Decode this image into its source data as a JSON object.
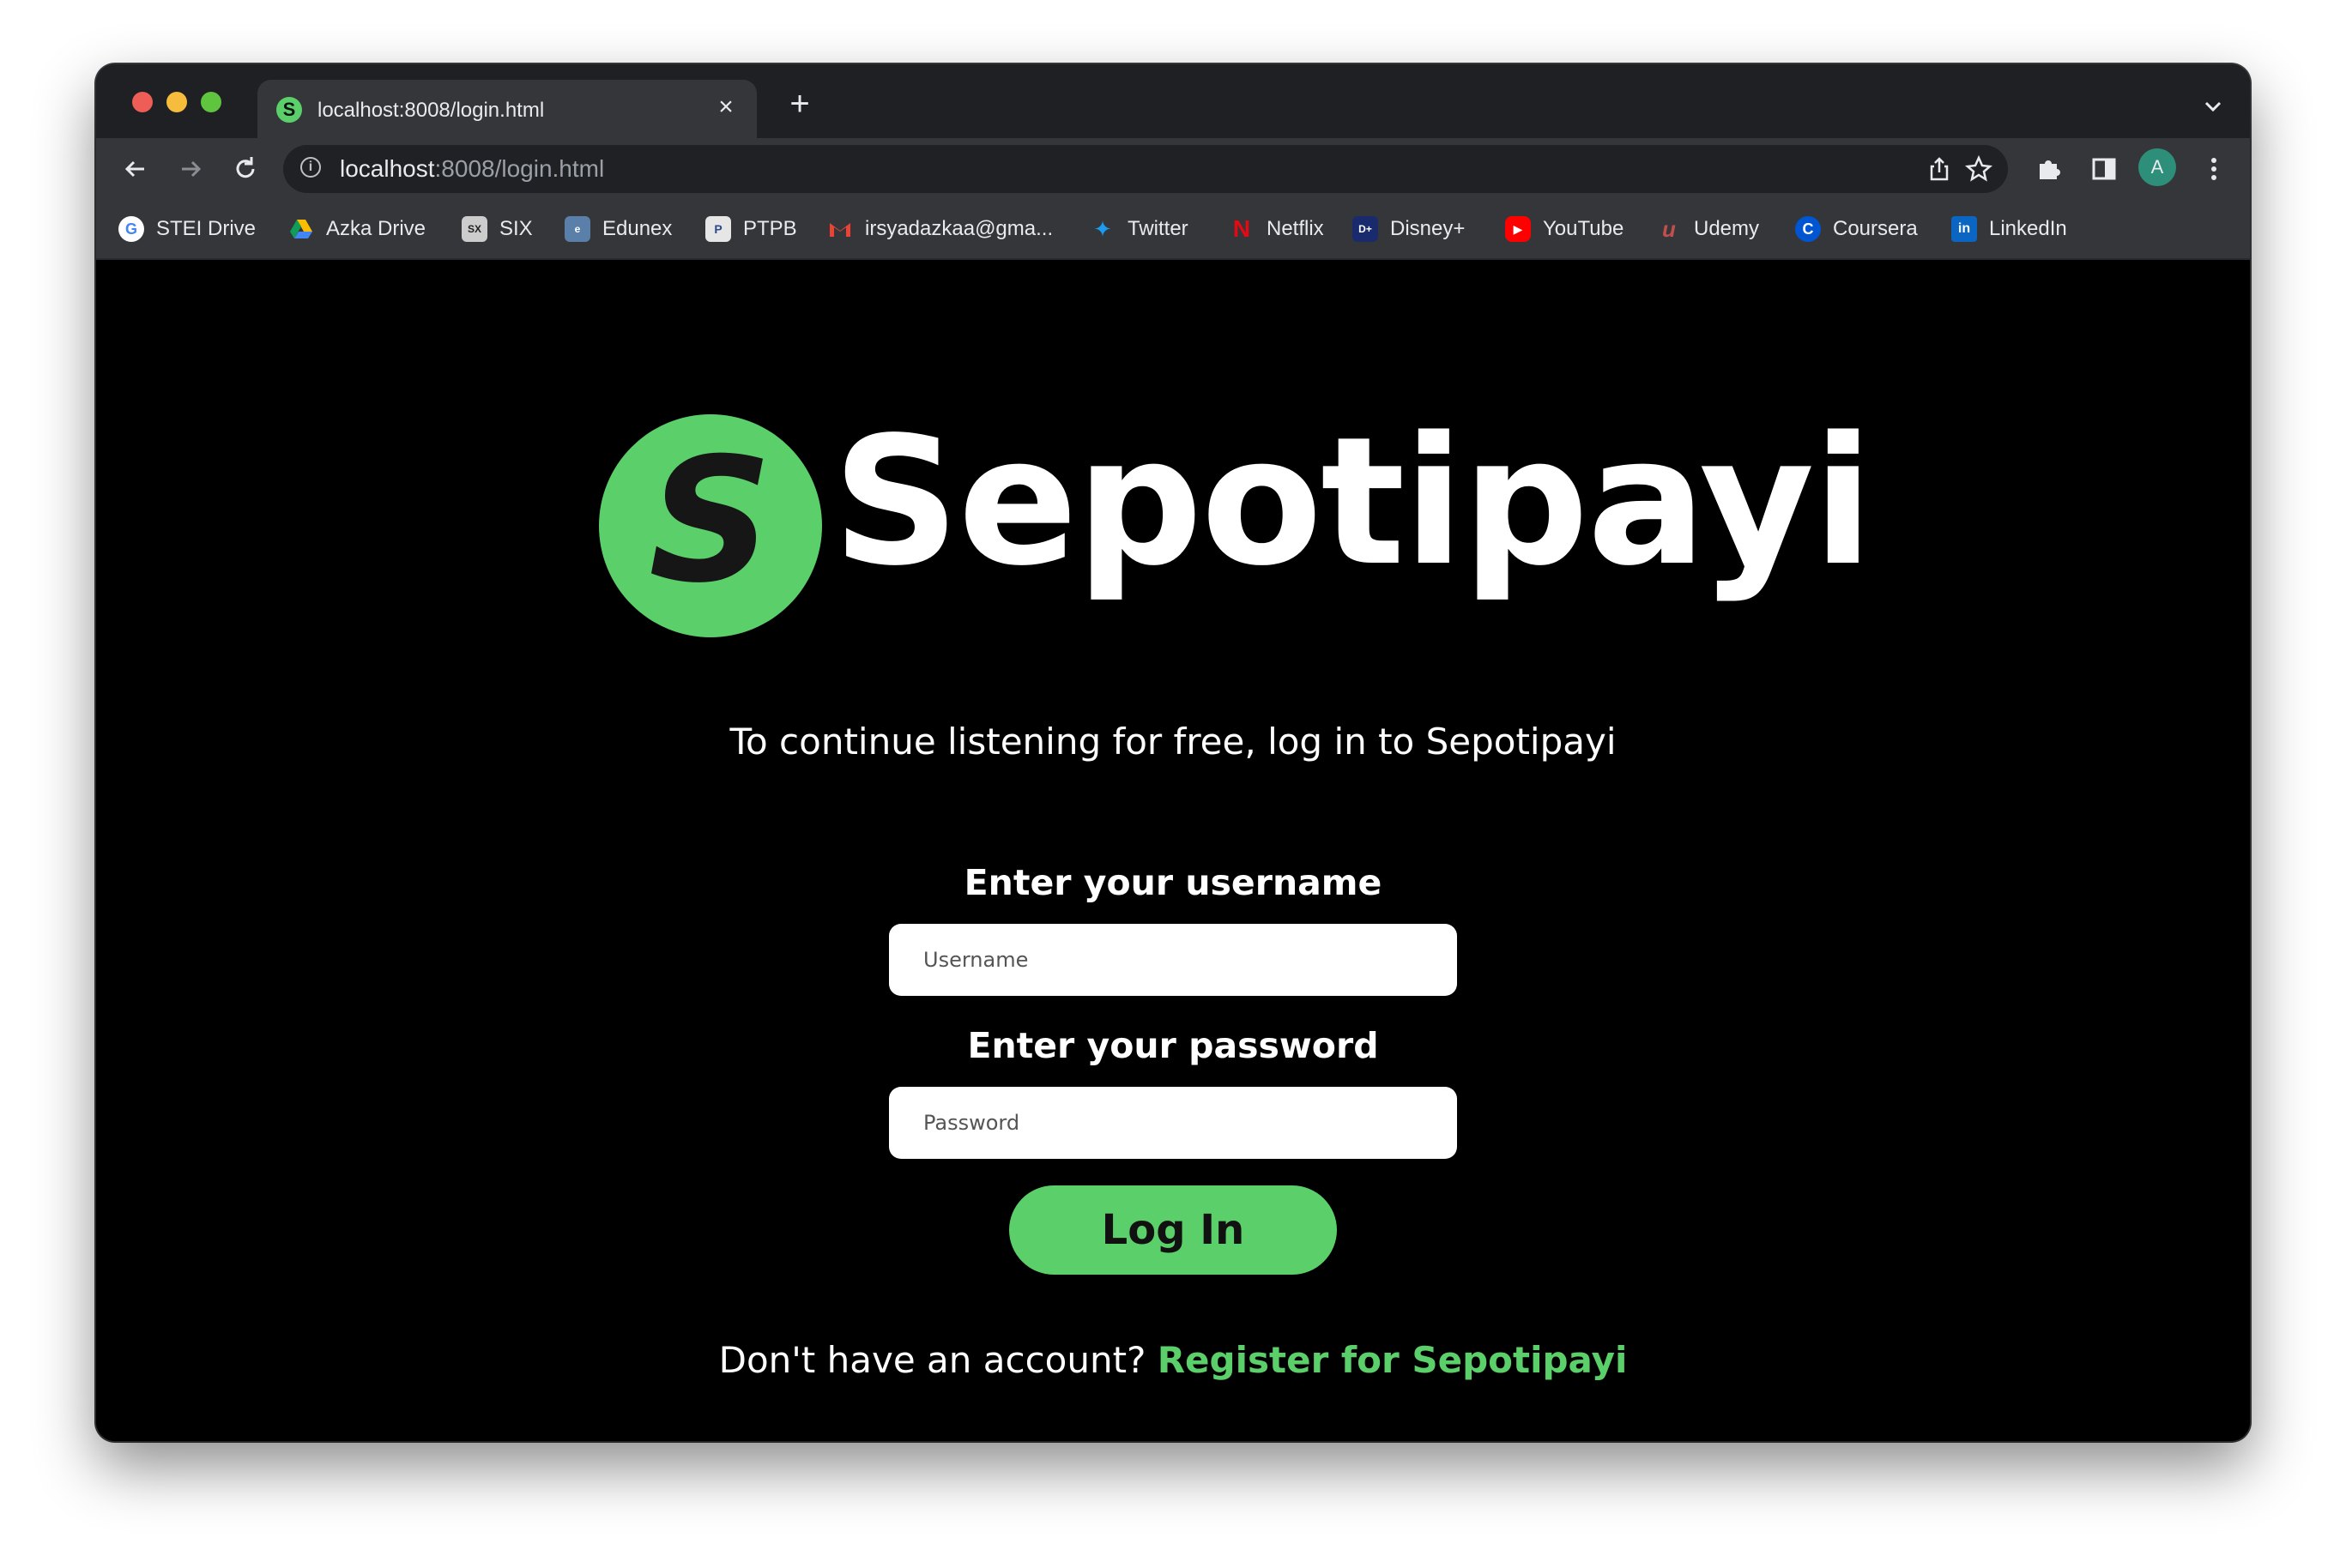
{
  "browser": {
    "tab": {
      "title": "localhost:8008/login.html",
      "favicon_letter": "S",
      "close_icon": "×"
    },
    "new_tab_icon": "+",
    "address": {
      "host": "localhost",
      "rest": ":8008/login.html"
    },
    "profile_initial": "A",
    "bookmarks": [
      {
        "label": "STEI Drive",
        "icon": "google-icon"
      },
      {
        "label": "Azka Drive",
        "icon": "google-drive-icon"
      },
      {
        "label": "SIX",
        "icon": "six-icon"
      },
      {
        "label": "Edunex",
        "icon": "edunex-icon"
      },
      {
        "label": "PTPB",
        "icon": "ptpb-icon"
      },
      {
        "label": "irsyadazkaa@gma...",
        "icon": "gmail-icon"
      },
      {
        "label": "Twitter",
        "icon": "twitter-icon"
      },
      {
        "label": "Netflix",
        "icon": "netflix-icon"
      },
      {
        "label": "Disney+",
        "icon": "disney-plus-icon"
      },
      {
        "label": "YouTube",
        "icon": "youtube-icon"
      },
      {
        "label": "Udemy",
        "icon": "udemy-icon"
      },
      {
        "label": "Coursera",
        "icon": "coursera-icon"
      },
      {
        "label": "LinkedIn",
        "icon": "linkedin-icon"
      }
    ]
  },
  "page": {
    "logo_letter": "S",
    "brand": "Sepotipayi",
    "subtitle": "To continue listening for free, log in to Sepotipayi",
    "username_label": "Enter your username",
    "username_placeholder": "Username",
    "password_label": "Enter your password",
    "password_placeholder": "Password",
    "login_button": "Log In",
    "register_prompt": "Don't have an account? ",
    "register_link": "Register for Sepotipayi",
    "accent_color": "#5bd06a"
  }
}
